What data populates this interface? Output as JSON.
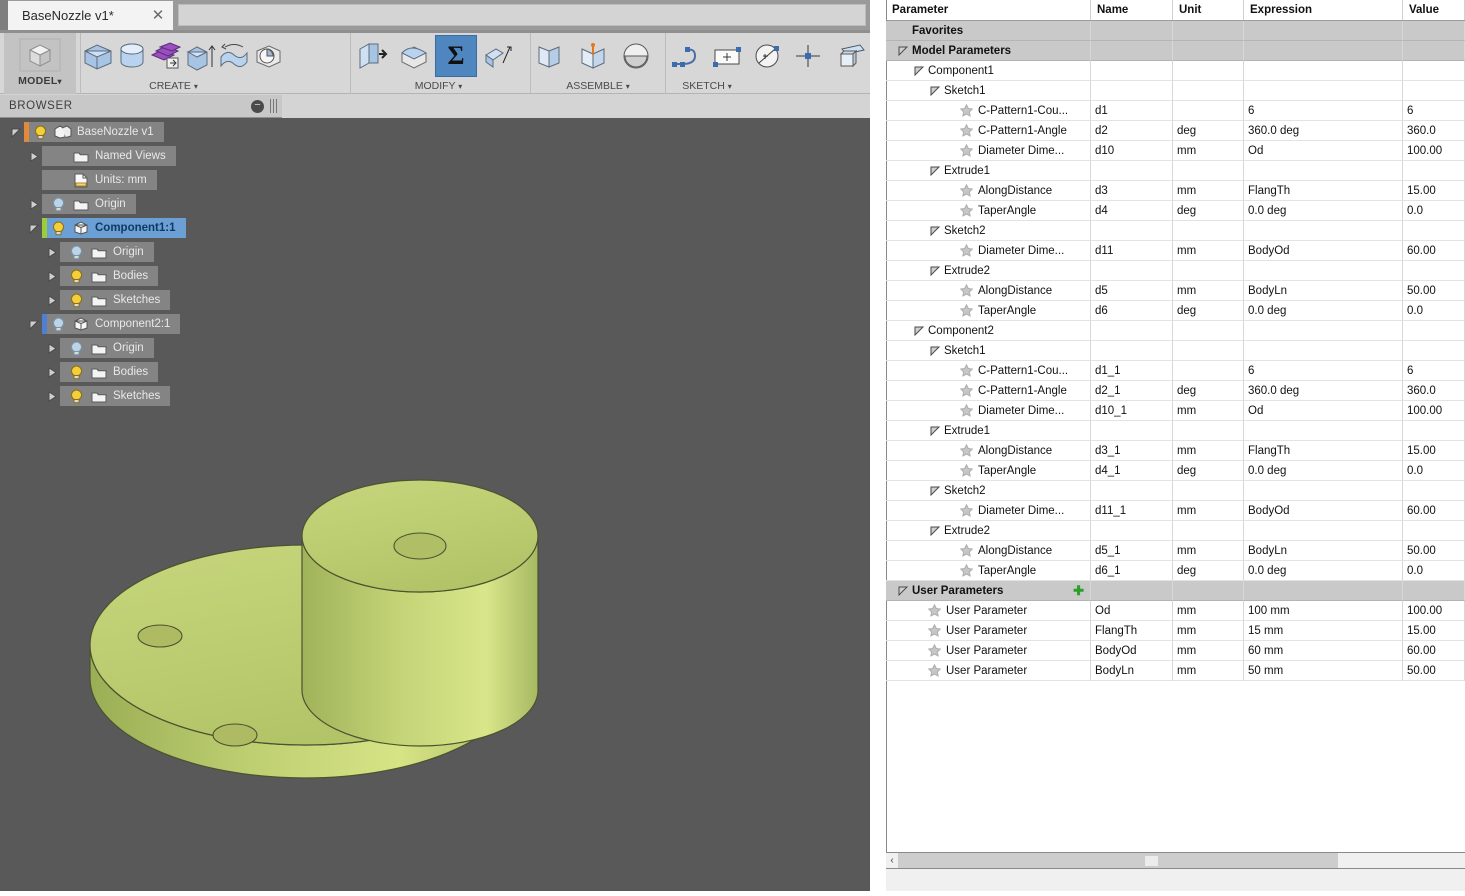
{
  "window": {
    "tab_title": "BaseNozzle v1*",
    "close_label": "✕"
  },
  "ribbon": {
    "model_label": "MODEL",
    "caret": "▾",
    "groups": [
      {
        "caption": "CREATE",
        "icons": [
          "extrude-icon",
          "revolve-icon",
          "pattern-icon",
          "press-pull-icon",
          "sweep-icon",
          "loft-icon"
        ]
      },
      {
        "caption": "MODIFY",
        "icons": [
          "shell-icon",
          "draft-icon",
          "change-parameters-icon",
          "split-face-icon"
        ]
      },
      {
        "caption": "ASSEMBLE",
        "icons": [
          "new-component-icon",
          "joint-icon",
          "as-built-joint-icon"
        ]
      },
      {
        "caption": "SKETCH",
        "icons": [
          "spline-icon",
          "rectangle-icon",
          "circle-icon",
          "point-icon",
          "create-sketch-icon"
        ]
      }
    ],
    "selected_icon": "change-parameters-icon"
  },
  "browser": {
    "header_title": "BROWSER",
    "collapse_icon": "minus-circle-icon",
    "grip_icon": "grip-handle-icon",
    "tree": [
      {
        "label": "BaseNozzle v1",
        "indent": 0,
        "twist": "open",
        "bar": "#e08a3c",
        "bulb": "on",
        "icon": "document-icon",
        "selected": false
      },
      {
        "label": "Named Views",
        "indent": 1,
        "twist": "closed",
        "bar": "",
        "bulb": "",
        "icon": "folder-icon",
        "selected": false
      },
      {
        "label": "Units: mm",
        "indent": 1,
        "twist": "none",
        "bar": "",
        "bulb": "",
        "icon": "units-icon",
        "selected": false
      },
      {
        "label": "Origin",
        "indent": 1,
        "twist": "closed",
        "bar": "",
        "bulb": "off",
        "icon": "folder-icon",
        "selected": false
      },
      {
        "label": "Component1:1",
        "indent": 1,
        "twist": "open",
        "bar": "#9ccb3b",
        "bulb": "on",
        "icon": "component-icon",
        "selected": true
      },
      {
        "label": "Origin",
        "indent": 2,
        "twist": "closed",
        "bar": "",
        "bulb": "off",
        "icon": "folder-icon",
        "selected": false
      },
      {
        "label": "Bodies",
        "indent": 2,
        "twist": "closed",
        "bar": "",
        "bulb": "on",
        "icon": "folder-icon",
        "selected": false
      },
      {
        "label": "Sketches",
        "indent": 2,
        "twist": "closed",
        "bar": "",
        "bulb": "on",
        "icon": "folder-icon",
        "selected": false
      },
      {
        "label": "Component2:1",
        "indent": 1,
        "twist": "open",
        "bar": "#4f7fd0",
        "bulb": "off",
        "icon": "component-icon",
        "selected": false
      },
      {
        "label": "Origin",
        "indent": 2,
        "twist": "closed",
        "bar": "",
        "bulb": "off",
        "icon": "folder-icon",
        "selected": false
      },
      {
        "label": "Bodies",
        "indent": 2,
        "twist": "closed",
        "bar": "",
        "bulb": "on",
        "icon": "folder-icon",
        "selected": false
      },
      {
        "label": "Sketches",
        "indent": 2,
        "twist": "closed",
        "bar": "",
        "bulb": "on",
        "icon": "folder-icon",
        "selected": false
      }
    ]
  },
  "viewport": {
    "background_color": "#59595a",
    "model_color": "#b9c96b",
    "model_name": "flanged-nozzle-model"
  },
  "parameters": {
    "columns": [
      "Parameter",
      "Name",
      "Unit",
      "Expression",
      "Value"
    ],
    "add_icon": "plus-icon",
    "rows": [
      {
        "kind": "group",
        "indent": 0,
        "twist": "none",
        "param": "Favorites",
        "name": "",
        "unit": "",
        "expr": "",
        "value": ""
      },
      {
        "kind": "group",
        "indent": 0,
        "twist": "open",
        "param": "Model Parameters",
        "name": "",
        "unit": "",
        "expr": "",
        "value": ""
      },
      {
        "kind": "subgroup",
        "indent": 1,
        "twist": "open",
        "param": "Component1",
        "name": "",
        "unit": "",
        "expr": "",
        "value": ""
      },
      {
        "kind": "subgroup",
        "indent": 2,
        "twist": "open",
        "param": "Sketch1",
        "name": "",
        "unit": "",
        "expr": "",
        "value": ""
      },
      {
        "kind": "item",
        "indent": 3,
        "twist": "none",
        "param": "C-Pattern1-Cou...",
        "name": "d1",
        "unit": "",
        "expr": "6",
        "value": "6"
      },
      {
        "kind": "item",
        "indent": 3,
        "twist": "none",
        "param": "C-Pattern1-Angle",
        "name": "d2",
        "unit": "deg",
        "expr": "360.0 deg",
        "value": "360.0"
      },
      {
        "kind": "item",
        "indent": 3,
        "twist": "none",
        "param": "Diameter Dime...",
        "name": "d10",
        "unit": "mm",
        "expr": "Od",
        "value": "100.00"
      },
      {
        "kind": "subgroup",
        "indent": 2,
        "twist": "open",
        "param": "Extrude1",
        "name": "",
        "unit": "",
        "expr": "",
        "value": ""
      },
      {
        "kind": "item",
        "indent": 3,
        "twist": "none",
        "param": "AlongDistance",
        "name": "d3",
        "unit": "mm",
        "expr": "FlangTh",
        "value": "15.00"
      },
      {
        "kind": "item",
        "indent": 3,
        "twist": "none",
        "param": "TaperAngle",
        "name": "d4",
        "unit": "deg",
        "expr": "0.0 deg",
        "value": "0.0"
      },
      {
        "kind": "subgroup",
        "indent": 2,
        "twist": "open",
        "param": "Sketch2",
        "name": "",
        "unit": "",
        "expr": "",
        "value": ""
      },
      {
        "kind": "item",
        "indent": 3,
        "twist": "none",
        "param": "Diameter Dime...",
        "name": "d11",
        "unit": "mm",
        "expr": "BodyOd",
        "value": "60.00"
      },
      {
        "kind": "subgroup",
        "indent": 2,
        "twist": "open",
        "param": "Extrude2",
        "name": "",
        "unit": "",
        "expr": "",
        "value": ""
      },
      {
        "kind": "item",
        "indent": 3,
        "twist": "none",
        "param": "AlongDistance",
        "name": "d5",
        "unit": "mm",
        "expr": "BodyLn",
        "value": "50.00"
      },
      {
        "kind": "item",
        "indent": 3,
        "twist": "none",
        "param": "TaperAngle",
        "name": "d6",
        "unit": "deg",
        "expr": "0.0 deg",
        "value": "0.0"
      },
      {
        "kind": "subgroup",
        "indent": 1,
        "twist": "open",
        "param": "Component2",
        "name": "",
        "unit": "",
        "expr": "",
        "value": ""
      },
      {
        "kind": "subgroup",
        "indent": 2,
        "twist": "open",
        "param": "Sketch1",
        "name": "",
        "unit": "",
        "expr": "",
        "value": ""
      },
      {
        "kind": "item",
        "indent": 3,
        "twist": "none",
        "param": "C-Pattern1-Cou...",
        "name": "d1_1",
        "unit": "",
        "expr": "6",
        "value": "6"
      },
      {
        "kind": "item",
        "indent": 3,
        "twist": "none",
        "param": "C-Pattern1-Angle",
        "name": "d2_1",
        "unit": "deg",
        "expr": "360.0 deg",
        "value": "360.0"
      },
      {
        "kind": "item",
        "indent": 3,
        "twist": "none",
        "param": "Diameter Dime...",
        "name": "d10_1",
        "unit": "mm",
        "expr": "Od",
        "value": "100.00"
      },
      {
        "kind": "subgroup",
        "indent": 2,
        "twist": "open",
        "param": "Extrude1",
        "name": "",
        "unit": "",
        "expr": "",
        "value": ""
      },
      {
        "kind": "item",
        "indent": 3,
        "twist": "none",
        "param": "AlongDistance",
        "name": "d3_1",
        "unit": "mm",
        "expr": "FlangTh",
        "value": "15.00"
      },
      {
        "kind": "item",
        "indent": 3,
        "twist": "none",
        "param": "TaperAngle",
        "name": "d4_1",
        "unit": "deg",
        "expr": "0.0 deg",
        "value": "0.0"
      },
      {
        "kind": "subgroup",
        "indent": 2,
        "twist": "open",
        "param": "Sketch2",
        "name": "",
        "unit": "",
        "expr": "",
        "value": ""
      },
      {
        "kind": "item",
        "indent": 3,
        "twist": "none",
        "param": "Diameter Dime...",
        "name": "d11_1",
        "unit": "mm",
        "expr": "BodyOd",
        "value": "60.00"
      },
      {
        "kind": "subgroup",
        "indent": 2,
        "twist": "open",
        "param": "Extrude2",
        "name": "",
        "unit": "",
        "expr": "",
        "value": ""
      },
      {
        "kind": "item",
        "indent": 3,
        "twist": "none",
        "param": "AlongDistance",
        "name": "d5_1",
        "unit": "mm",
        "expr": "BodyLn",
        "value": "50.00"
      },
      {
        "kind": "item",
        "indent": 3,
        "twist": "none",
        "param": "TaperAngle",
        "name": "d6_1",
        "unit": "deg",
        "expr": "0.0 deg",
        "value": "0.0"
      },
      {
        "kind": "group",
        "indent": 0,
        "twist": "open",
        "param": "User Parameters",
        "name": "",
        "unit": "",
        "expr": "",
        "value": "",
        "add": true
      },
      {
        "kind": "item",
        "indent": 1,
        "twist": "none",
        "param": "User Parameter",
        "name": "Od",
        "unit": "mm",
        "expr": "100 mm",
        "value": "100.00"
      },
      {
        "kind": "item",
        "indent": 1,
        "twist": "none",
        "param": "User Parameter",
        "name": "FlangTh",
        "unit": "mm",
        "expr": "15 mm",
        "value": "15.00"
      },
      {
        "kind": "item",
        "indent": 1,
        "twist": "none",
        "param": "User Parameter",
        "name": "BodyOd",
        "unit": "mm",
        "expr": "60 mm",
        "value": "60.00"
      },
      {
        "kind": "item",
        "indent": 1,
        "twist": "none",
        "param": "User Parameter",
        "name": "BodyLn",
        "unit": "mm",
        "expr": "50 mm",
        "value": "50.00"
      }
    ]
  },
  "scrollbar": {
    "left_arrow": "‹",
    "name": "horizontal-scrollbar"
  }
}
